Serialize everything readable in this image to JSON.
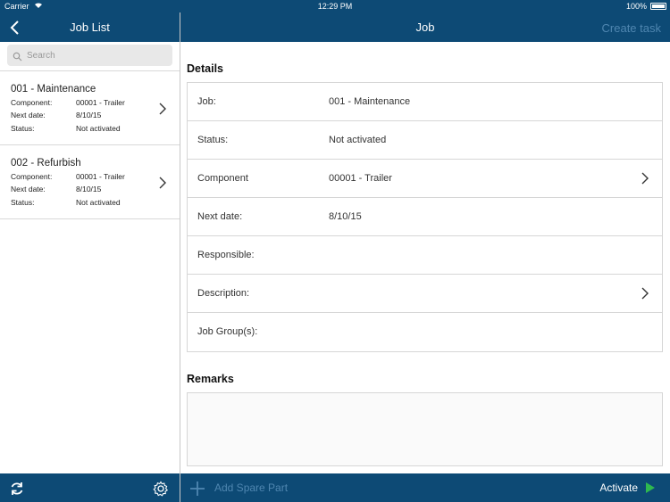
{
  "statusbar": {
    "carrier": "Carrier",
    "time": "12:29 PM",
    "battery": "100%"
  },
  "left_nav": {
    "title": "Job List"
  },
  "right_nav": {
    "title": "Job",
    "create_task": "Create task"
  },
  "search": {
    "placeholder": "Search"
  },
  "jobs": [
    {
      "name": "001 - Maintenance",
      "component_label": "Component:",
      "component": "00001 - Trailer",
      "next_date_label": "Next date:",
      "next_date": "8/10/15",
      "status_label": "Status:",
      "status": "Not activated"
    },
    {
      "name": "002 - Refurbish",
      "component_label": "Component:",
      "component": "00001 - Trailer",
      "next_date_label": "Next date:",
      "next_date": "8/10/15",
      "status_label": "Status:",
      "status": "Not activated"
    }
  ],
  "details": {
    "title": "Details",
    "rows": [
      {
        "label": "Job:",
        "value": "001 - Maintenance"
      },
      {
        "label": "Status:",
        "value": "Not activated"
      },
      {
        "label": "Component",
        "value": "00001 - Trailer"
      },
      {
        "label": "Next date:",
        "value": "8/10/15"
      },
      {
        "label": "Responsible:",
        "value": ""
      },
      {
        "label": "Description:",
        "value": ""
      },
      {
        "label": "Job Group(s):",
        "value": ""
      }
    ]
  },
  "remarks": {
    "title": "Remarks"
  },
  "toolbar": {
    "add_spare_part": "Add Spare Part",
    "activate": "Activate"
  },
  "colors": {
    "bar": "#0d4a75",
    "muted_link": "#4f86b0",
    "play": "#2fb84f"
  }
}
